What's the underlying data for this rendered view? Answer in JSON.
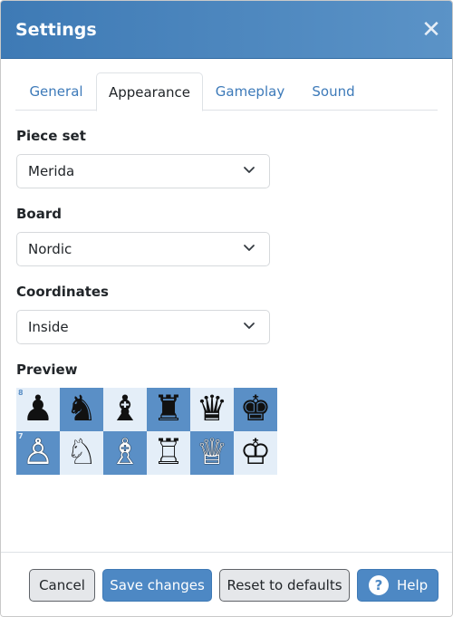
{
  "header": {
    "title": "Settings",
    "close_glyph": "✕"
  },
  "tabs": [
    {
      "label": "General",
      "active": false
    },
    {
      "label": "Appearance",
      "active": true
    },
    {
      "label": "Gameplay",
      "active": false
    },
    {
      "label": "Sound",
      "active": false
    }
  ],
  "fields": {
    "piece_set": {
      "label": "Piece set",
      "value": "Merida"
    },
    "board": {
      "label": "Board",
      "value": "Nordic"
    },
    "coordinates": {
      "label": "Coordinates",
      "value": "Inside"
    }
  },
  "preview": {
    "label": "Preview",
    "rank_labels": [
      "8",
      "7"
    ],
    "ranks": [
      [
        "♟",
        "♞",
        "♝",
        "♜",
        "♛",
        "♚"
      ],
      [
        "♙",
        "♘",
        "♗",
        "♖",
        "♕",
        "♔"
      ]
    ],
    "colors": {
      "light": "#e4eef8",
      "dark": "#5a8fc6"
    }
  },
  "footer": {
    "cancel": "Cancel",
    "save": "Save changes",
    "reset": "Reset to defaults",
    "help": "Help",
    "help_icon": "?"
  },
  "colors": {
    "header": "#4a86c0",
    "primary": "#4d88c4",
    "link": "#3d7ab9"
  }
}
